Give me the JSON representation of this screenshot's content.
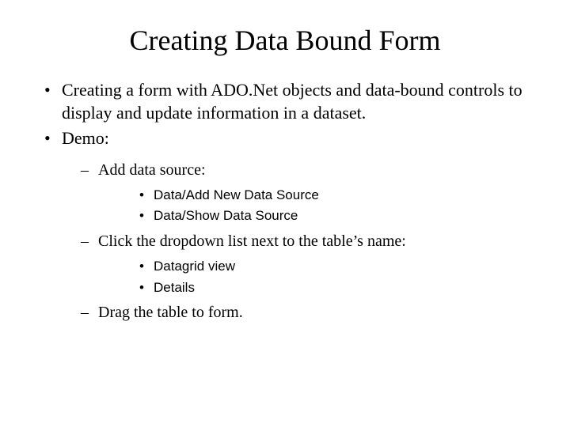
{
  "title": "Creating Data Bound Form",
  "bullets": {
    "b1": "Creating a form with ADO.Net objects and data-bound controls to display and update information in a dataset.",
    "b2": "Demo:",
    "sub": {
      "s1": "Add data source:",
      "s1_items": {
        "i1": "Data/Add New Data Source",
        "i2": "Data/Show Data Source"
      },
      "s2": "Click the dropdown list next to the table’s name:",
      "s2_items": {
        "i1": "Datagrid view",
        "i2": "Details"
      },
      "s3": "Drag the table to form."
    }
  }
}
